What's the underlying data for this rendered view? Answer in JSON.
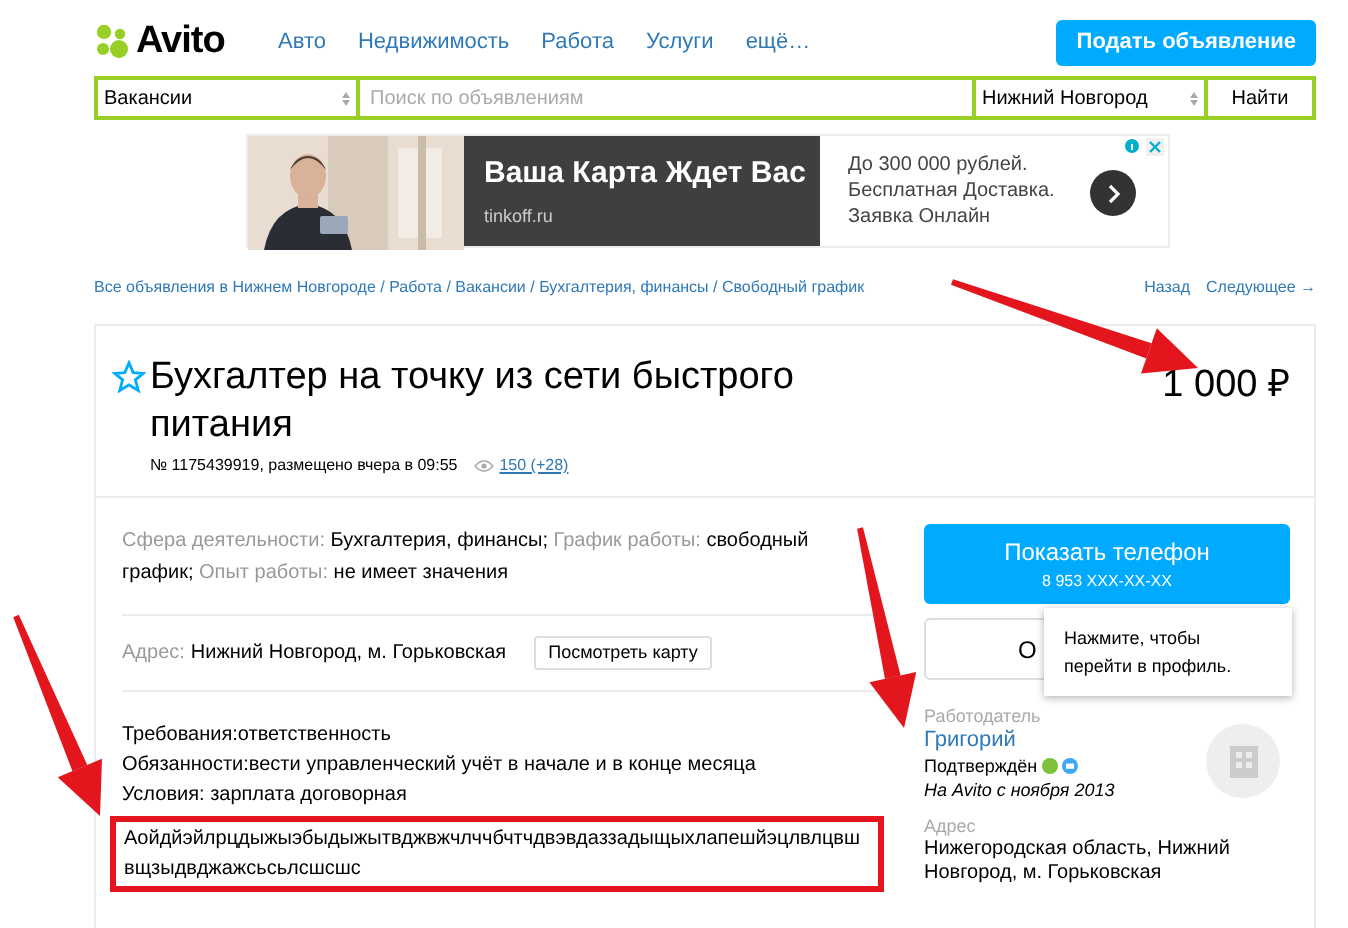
{
  "header": {
    "logo": "Avito",
    "nav": [
      "Авто",
      "Недвижимость",
      "Работа",
      "Услуги",
      "ещё…"
    ],
    "post_button": "Подать объявление"
  },
  "search": {
    "category": "Вакансии",
    "placeholder": "Поиск по объявлениям",
    "city": "Нижний Новгород",
    "button": "Найти"
  },
  "ad": {
    "headline": "Ваша Карта Ждет Вас",
    "domain": "tinkoff.ru",
    "lines": [
      "До 300 000 рублей.",
      "Бесплатная Доставка.",
      "Заявка Онлайн"
    ]
  },
  "breadcrumbs": "Все объявления в Нижнем Новгороде / Работа / Вакансии / Бухгалтерия, финансы / Свободный график",
  "pager": [
    "Назад",
    "Следующее →"
  ],
  "listing": {
    "favorite": false,
    "title": "Бухгалтер на точку из сети быстрого питания",
    "price": "1 000 ₽",
    "meta": "№ 1175439919, размещено вчера в 09:55",
    "views": "150 (+28)"
  },
  "params": [
    {
      "label": "Сфера деятельности:",
      "value": "Бухгалтерия, финансы;"
    },
    {
      "label": "График работы:",
      "value": "свободный график;"
    },
    {
      "label": "Опыт работы:",
      "value": "не имеет значения"
    }
  ],
  "address": {
    "label": "Адрес:",
    "value": "Нижний Новгород, м. Горьковская",
    "button": "Посмотреть карту"
  },
  "description": [
    "Требования:ответственность",
    "Обязанности:вести управленческий учёт в начале и в конце месяца",
    "Условия: зарплата договорная"
  ],
  "highlighted": "Аойдйэйлрцдыжыэбыдыжытвджвжчлччбчтчдвэвдаззадыщыхлапешйэцлвлцвш вщзыдвджажсьсьлсшсшс",
  "seller": {
    "phone_title": "Показать телефон",
    "phone": "8 953 XXX-XX-XX",
    "second_button": "О",
    "tooltip": "Нажмите, чтобы перейти в профиль.",
    "role": "Работодатель",
    "name": "Григорий",
    "verified": "Подтверждён",
    "since": "На Avito с ноября 2013",
    "address_label": "Адрес",
    "address": "Нижегородская область, Нижний Новгород, м. Горьковская"
  }
}
